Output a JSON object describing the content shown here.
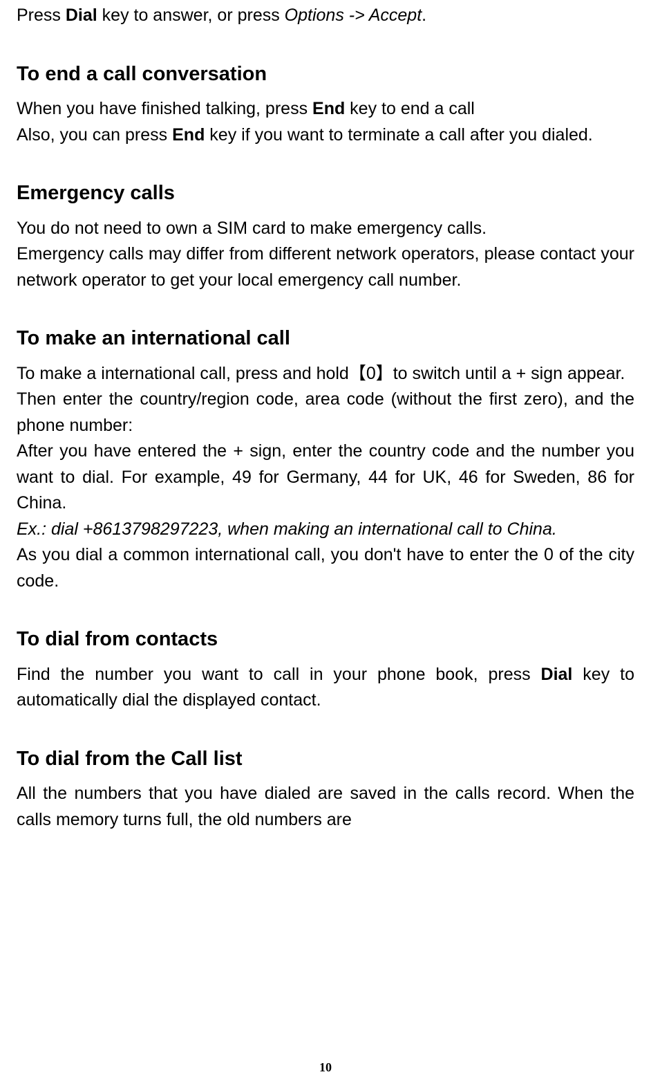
{
  "intro": {
    "p1_a": "Press ",
    "p1_b": "Dial",
    "p1_c": " key to answer, or press ",
    "p1_d": "Options -> Accept",
    "p1_e": "."
  },
  "sec1": {
    "heading": "To end a call conversation",
    "p1_a": "When you have finished talking, press ",
    "p1_b": "End",
    "p1_c": " key to end a call",
    "p2_a": "Also, you can press ",
    "p2_b": "End",
    "p2_c": " key if you want to terminate a call after you dialed."
  },
  "sec2": {
    "heading": "Emergency calls",
    "p1": "You do not need to own a SIM card to make emergency calls.",
    "p2": "Emergency calls may differ from different network operators, please contact your network operator to get your local emergency call number."
  },
  "sec3": {
    "heading": "To make an international call",
    "p1": "To make a international call, press and hold【0】to switch until a + sign appear.",
    "p2": "Then enter the country/region code, area code (without the first zero), and the phone number:",
    "p3": "After you have entered the + sign, enter the country code and the number you want to dial. For example, 49 for Germany, 44 for UK, 46 for Sweden, 86 for China.",
    "p4": "Ex.: dial +8613798297223, when making an international call to China.",
    "p5": "As you dial a common international call, you don't have to enter the 0 of the city code."
  },
  "sec4": {
    "heading": "To dial from contacts",
    "p1_a": "Find the number you want to call in your phone book, press ",
    "p1_b": "Dial",
    "p1_c": " key to automatically dial the displayed contact."
  },
  "sec5": {
    "heading": "To dial from the Call list",
    "p1": "All the numbers that you have dialed are saved in the calls record. When the calls memory turns full, the old numbers are"
  },
  "page": "10"
}
